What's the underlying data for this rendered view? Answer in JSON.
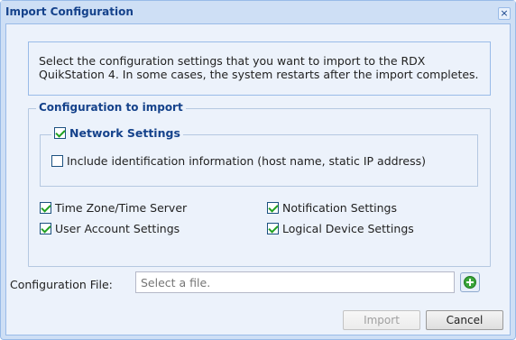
{
  "dialog": {
    "title": "Import Configuration",
    "close_label": "×"
  },
  "intro": {
    "text": "Select the configuration settings that you want to import to the RDX QuikStation 4. In some cases, the system restarts after the import completes."
  },
  "config": {
    "legend": "Configuration to import",
    "network": {
      "label": "Network Settings",
      "checked": true,
      "include_id": {
        "label": "Include identification information (host name, static IP address)",
        "checked": false
      }
    },
    "options": [
      {
        "label": "Time Zone/Time Server",
        "checked": true
      },
      {
        "label": "Notification Settings",
        "checked": true
      },
      {
        "label": "User Account Settings",
        "checked": true
      },
      {
        "label": "Logical Device Settings",
        "checked": true
      }
    ]
  },
  "file": {
    "label": "Configuration File:",
    "placeholder": "Select a file.",
    "value": ""
  },
  "buttons": {
    "import": "Import",
    "cancel": "Cancel"
  },
  "colors": {
    "title": "#15428b",
    "check": "#21a121",
    "add_icon": "#3aa53a"
  }
}
